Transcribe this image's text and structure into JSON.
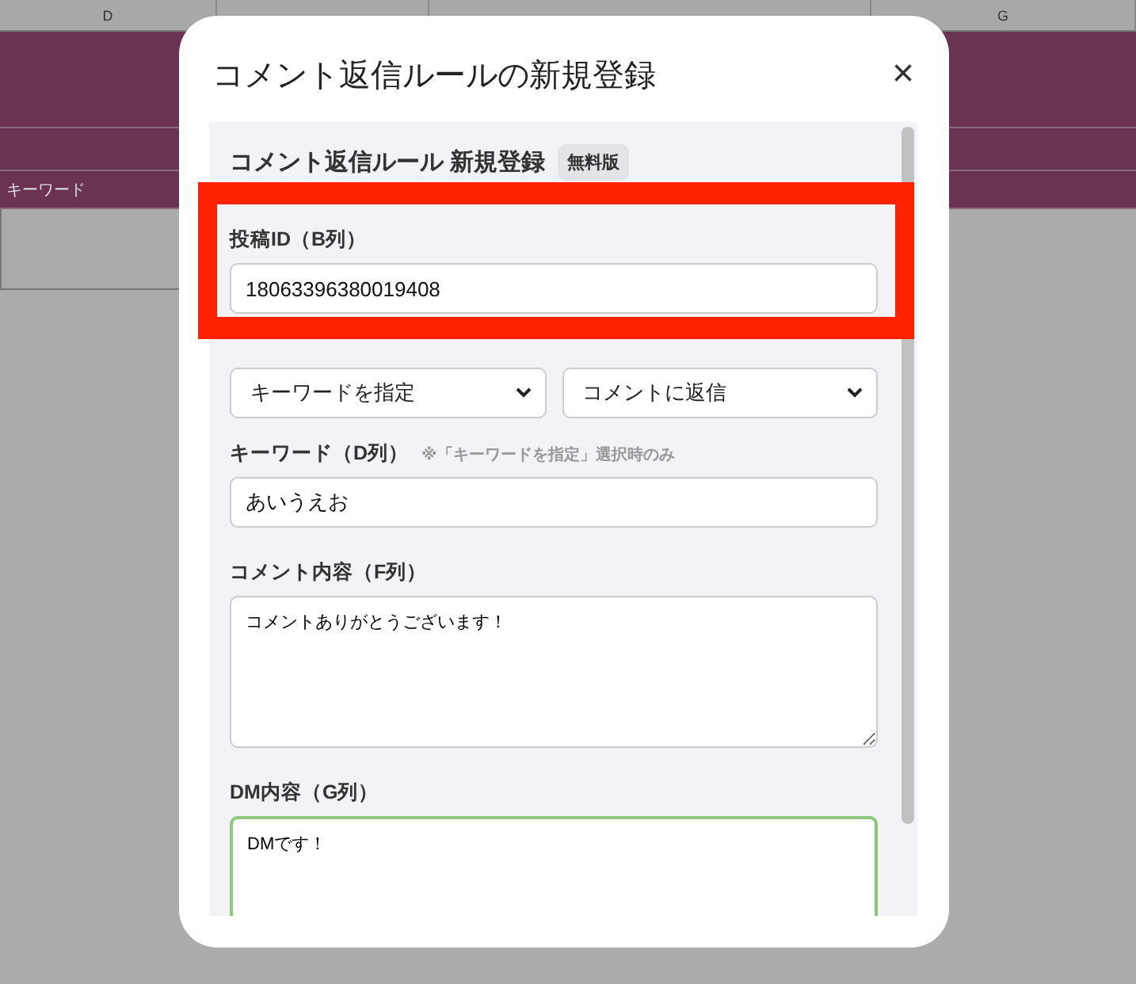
{
  "sheet": {
    "headers": [
      {
        "label": "D"
      },
      {
        "label": "G"
      }
    ],
    "cell": "キーワード"
  },
  "dialog": {
    "title": "コメント返信ルールの新規登録",
    "close": "×",
    "heading": "コメント返信ルール 新規登録",
    "badge": "無料版",
    "post_id": {
      "label": "投稿ID（B列）",
      "value": "18063396380019408"
    },
    "selects": [
      {
        "value": "キーワードを指定"
      },
      {
        "value": "コメントに返信"
      }
    ],
    "keyword": {
      "label": "キーワード（D列）",
      "note": "※「キーワードを指定」選択時のみ",
      "value": "あいうえお"
    },
    "comment": {
      "label": "コメント内容（F列）",
      "value": "コメントありがとうございます！"
    },
    "dm": {
      "label": "DM内容（G列）",
      "value": "DMです！",
      "focused": true
    }
  }
}
